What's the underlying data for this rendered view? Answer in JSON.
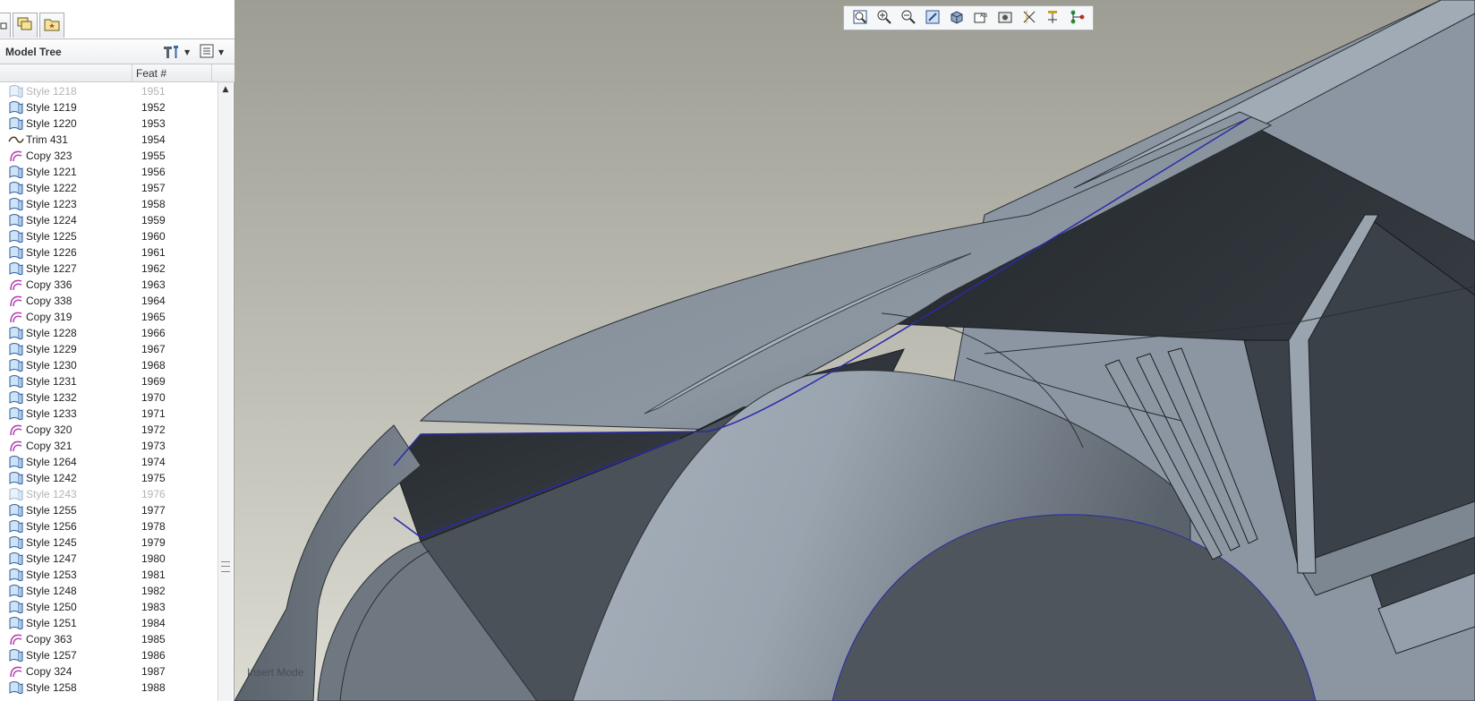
{
  "left_panel": {
    "tabs": [
      {
        "name": "tab-collapsed",
        "icon": "small-square-icon"
      },
      {
        "name": "tab-layers",
        "icon": "layers-icon"
      },
      {
        "name": "tab-favorites",
        "icon": "folder-star-icon"
      }
    ],
    "model_tree": {
      "title": "Model Tree",
      "settings_icon": "hammer-tools-icon",
      "show_icon": "list-icon",
      "columns": {
        "name": "",
        "feat": "Feat #"
      },
      "rows": [
        {
          "name": "Style 1218",
          "feat": "1951",
          "type": "style",
          "suppressed": true
        },
        {
          "name": "Style 1219",
          "feat": "1952",
          "type": "style",
          "suppressed": false
        },
        {
          "name": "Style 1220",
          "feat": "1953",
          "type": "style",
          "suppressed": false
        },
        {
          "name": "Trim 431",
          "feat": "1954",
          "type": "trim",
          "suppressed": false
        },
        {
          "name": "Copy 323",
          "feat": "1955",
          "type": "copy",
          "suppressed": false
        },
        {
          "name": "Style 1221",
          "feat": "1956",
          "type": "style",
          "suppressed": false
        },
        {
          "name": "Style 1222",
          "feat": "1957",
          "type": "style",
          "suppressed": false
        },
        {
          "name": "Style 1223",
          "feat": "1958",
          "type": "style",
          "suppressed": false
        },
        {
          "name": "Style 1224",
          "feat": "1959",
          "type": "style",
          "suppressed": false
        },
        {
          "name": "Style 1225",
          "feat": "1960",
          "type": "style",
          "suppressed": false
        },
        {
          "name": "Style 1226",
          "feat": "1961",
          "type": "style",
          "suppressed": false
        },
        {
          "name": "Style 1227",
          "feat": "1962",
          "type": "style",
          "suppressed": false
        },
        {
          "name": "Copy 336",
          "feat": "1963",
          "type": "copy",
          "suppressed": false
        },
        {
          "name": "Copy 338",
          "feat": "1964",
          "type": "copy",
          "suppressed": false
        },
        {
          "name": "Copy 319",
          "feat": "1965",
          "type": "copy",
          "suppressed": false
        },
        {
          "name": "Style 1228",
          "feat": "1966",
          "type": "style",
          "suppressed": false
        },
        {
          "name": "Style 1229",
          "feat": "1967",
          "type": "style",
          "suppressed": false
        },
        {
          "name": "Style 1230",
          "feat": "1968",
          "type": "style",
          "suppressed": false
        },
        {
          "name": "Style 1231",
          "feat": "1969",
          "type": "style",
          "suppressed": false
        },
        {
          "name": "Style 1232",
          "feat": "1970",
          "type": "style",
          "suppressed": false
        },
        {
          "name": "Style 1233",
          "feat": "1971",
          "type": "style",
          "suppressed": false
        },
        {
          "name": "Copy 320",
          "feat": "1972",
          "type": "copy",
          "suppressed": false
        },
        {
          "name": "Copy 321",
          "feat": "1973",
          "type": "copy",
          "suppressed": false
        },
        {
          "name": "Style 1264",
          "feat": "1974",
          "type": "style",
          "suppressed": false
        },
        {
          "name": "Style 1242",
          "feat": "1975",
          "type": "style",
          "suppressed": false
        },
        {
          "name": "Style 1243",
          "feat": "1976",
          "type": "style",
          "suppressed": true
        },
        {
          "name": "Style 1255",
          "feat": "1977",
          "type": "style",
          "suppressed": false
        },
        {
          "name": "Style 1256",
          "feat": "1978",
          "type": "style",
          "suppressed": false
        },
        {
          "name": "Style 1245",
          "feat": "1979",
          "type": "style",
          "suppressed": false
        },
        {
          "name": "Style 1247",
          "feat": "1980",
          "type": "style",
          "suppressed": false
        },
        {
          "name": "Style 1253",
          "feat": "1981",
          "type": "style",
          "suppressed": false
        },
        {
          "name": "Style 1248",
          "feat": "1982",
          "type": "style",
          "suppressed": false
        },
        {
          "name": "Style 1250",
          "feat": "1983",
          "type": "style",
          "suppressed": false
        },
        {
          "name": "Style 1251",
          "feat": "1984",
          "type": "style",
          "suppressed": false
        },
        {
          "name": "Copy 363",
          "feat": "1985",
          "type": "copy",
          "suppressed": false
        },
        {
          "name": "Style 1257",
          "feat": "1986",
          "type": "style",
          "suppressed": false
        },
        {
          "name": "Copy 324",
          "feat": "1987",
          "type": "copy",
          "suppressed": false
        },
        {
          "name": "Style 1258",
          "feat": "1988",
          "type": "style",
          "suppressed": false
        }
      ]
    }
  },
  "graphics": {
    "status_text": "Insert Mode",
    "toolbar_icons": [
      "refit-icon",
      "zoom-in-icon",
      "zoom-out-icon",
      "repaint-icon",
      "display-style-icon",
      "saved-views-icon",
      "view-manager-icon",
      "datum-display-icon",
      "spin-center-icon",
      "annotation-display-icon"
    ]
  },
  "colors": {
    "viewport_bg_top": "#9d9d93",
    "viewport_bg_bottom": "#dcdcd2",
    "model_light": "#8f9aa6",
    "model_dark": "#2d3237",
    "selection_edge": "#2a2aa8"
  }
}
